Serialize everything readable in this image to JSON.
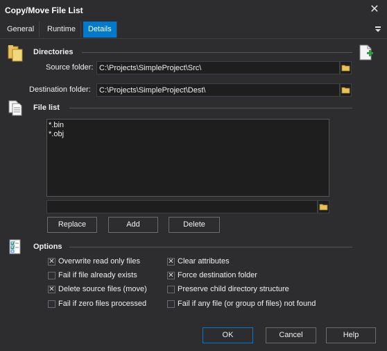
{
  "window": {
    "title": "Copy/Move File List",
    "close_glyph": "✕"
  },
  "tabs": [
    {
      "label": "General",
      "active": false
    },
    {
      "label": "Runtime",
      "active": false
    },
    {
      "label": "Details",
      "active": true
    }
  ],
  "directories": {
    "heading": "Directories",
    "source_label": "Source folder:",
    "source_value": "C:\\Projects\\SimpleProject\\Src\\",
    "dest_label": "Destination folder:",
    "dest_value": "C:\\Projects\\SimpleProject\\Dest\\"
  },
  "file_list": {
    "heading": "File list",
    "items": [
      "*.bin",
      "*.obj"
    ],
    "entry_value": "",
    "replace_label": "Replace",
    "add_label": "Add",
    "delete_label": "Delete"
  },
  "options": {
    "heading": "Options",
    "left": [
      {
        "label": "Overwrite read only files",
        "checked": true
      },
      {
        "label": "Fail if file already exists",
        "checked": false
      },
      {
        "label": "Delete source files (move)",
        "checked": true
      },
      {
        "label": "Fail if zero files processed",
        "checked": false
      }
    ],
    "right": [
      {
        "label": "Clear attributes",
        "checked": true
      },
      {
        "label": "Force destination folder",
        "checked": true
      },
      {
        "label": "Preserve child directory structure",
        "checked": false
      },
      {
        "label": "Fail if any file (or group of files) not found",
        "checked": false
      }
    ]
  },
  "footer": {
    "ok_label": "OK",
    "cancel_label": "Cancel",
    "help_label": "Help"
  },
  "colors": {
    "background": "#2d2d30",
    "accent": "#007acc",
    "field": "#1e1e1e"
  }
}
